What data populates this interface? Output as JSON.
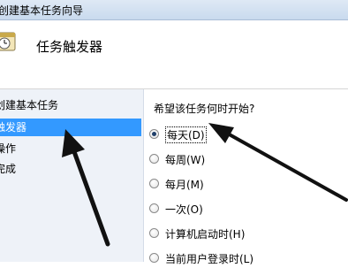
{
  "window": {
    "title": "创建基本任务向导"
  },
  "header": {
    "title": "任务触发器",
    "icon": "task-scheduler-clock-icon"
  },
  "sidebar": {
    "items": [
      {
        "label": "创建基本任务"
      },
      {
        "label": "触发器"
      },
      {
        "label": "操作"
      },
      {
        "label": "完成"
      }
    ],
    "active_index": 1
  },
  "trigger": {
    "question": "希望该任务何时开始?",
    "options": [
      {
        "label": "每天(D)",
        "checked": true
      },
      {
        "label": "每周(W)",
        "checked": false
      },
      {
        "label": "每月(M)",
        "checked": false
      },
      {
        "label": "一次(O)",
        "checked": false
      },
      {
        "label": "计算机启动时(H)",
        "checked": false
      },
      {
        "label": "当前用户登录时(L)",
        "checked": false
      }
    ]
  },
  "colors": {
    "accent": "#3399ff",
    "sidebar_bg": "#eef2f8",
    "arrow": "#111111"
  }
}
